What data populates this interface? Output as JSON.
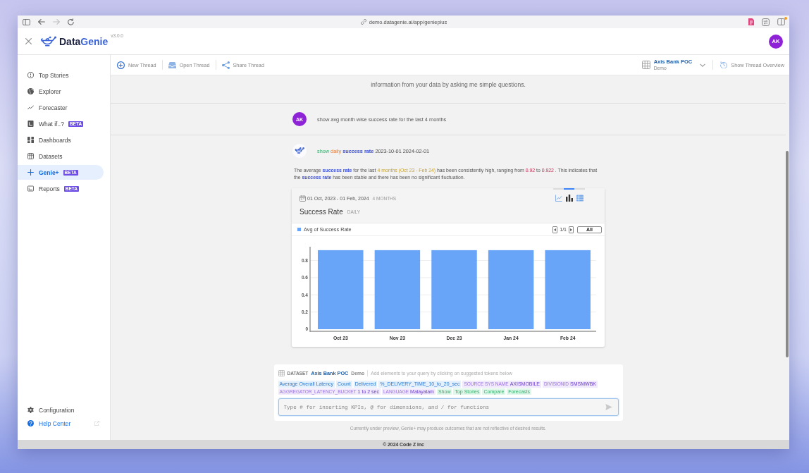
{
  "browser": {
    "url": "demo.datagenie.ai/app/genieplus",
    "can_go_forward": false,
    "notification_dot": true
  },
  "header": {
    "logo": [
      "Data",
      "Genie"
    ],
    "version": "v3.0.0",
    "avatar": "AK"
  },
  "sidebar": {
    "items": [
      {
        "label": "Top Stories",
        "selected": false
      },
      {
        "label": "Explorer",
        "selected": false
      },
      {
        "label": "Forecaster",
        "selected": false
      },
      {
        "label": "What if..?",
        "badge": "BETA",
        "selected": false
      },
      {
        "label": "Dashboards",
        "selected": false
      },
      {
        "label": "Datasets",
        "selected": false
      },
      {
        "label": "Genie+",
        "badge": "BETA",
        "selected": true
      },
      {
        "label": "Reports",
        "badge": "BETA",
        "selected": false
      }
    ],
    "footer_items": [
      {
        "label": "Configuration",
        "kind": "setting"
      },
      {
        "label": "Help Center",
        "kind": "external_link"
      }
    ]
  },
  "toolbar": {
    "actions": [
      "New Thread",
      "Open Thread",
      "Share Thread"
    ],
    "dataset": {
      "name": "Axis Bank POC",
      "tag": "Demo"
    },
    "overview_button": "Show Thread Overview"
  },
  "conversation": {
    "intro": "information from your data by asking me simple questions.",
    "user_message": {
      "avatar": "AK",
      "text": "show avg month wise success rate for the last 4 months"
    },
    "bot_response": {
      "query": [
        {
          "kind": "action",
          "text": "show"
        },
        {
          "kind": "grain",
          "text": "daily"
        },
        {
          "kind": "metric",
          "text": "success rate"
        },
        {
          "kind": "date",
          "text": "2023-10-01"
        },
        {
          "kind": "date",
          "text": "2024-02-01"
        }
      ],
      "summary": [
        {
          "kind": "plain",
          "text": "The average "
        },
        {
          "kind": "metric",
          "text": "success rate"
        },
        {
          "kind": "plain",
          "text": " for the last "
        },
        {
          "kind": "period",
          "text": "4 months (Oct 23 - Feb 24)"
        },
        {
          "kind": "plain",
          "text": " has been consistently high, ranging from "
        },
        {
          "kind": "value",
          "text": "0.92"
        },
        {
          "kind": "plain",
          "text": " to "
        },
        {
          "kind": "value",
          "text": "0.922"
        },
        {
          "kind": "plain",
          "text": " . This indicates that the "
        },
        {
          "kind": "metric",
          "text": "success rate"
        },
        {
          "kind": "plain",
          "text": " has been stable and there has been no significant fluctuation."
        }
      ],
      "chart_card": {
        "date_range": "01 Oct, 2023 - 01 Feb, 2024",
        "duration": "4 MONTHS",
        "title": "Success Rate",
        "grain": "DAILY",
        "views": [
          {
            "kind": "line",
            "selected": false
          },
          {
            "kind": "bar",
            "selected": true
          },
          {
            "kind": "table",
            "selected": false
          }
        ],
        "pager": {
          "page": "1/1",
          "all_button": "All"
        },
        "chart_data": {
          "type": "bar",
          "categories": [
            "Oct 23",
            "Nov 23",
            "Dec 23",
            "Jan 24",
            "Feb 24"
          ],
          "series": [
            {
              "name": "Avg of Success Rate",
              "color": "#68a4f8",
              "values": [
                0.92,
                0.92,
                0.92,
                0.92,
                0.92
              ]
            }
          ],
          "ylim": [
            0,
            0.96
          ],
          "yticks": [
            0,
            0.2,
            0.4,
            0.6,
            0.8
          ],
          "grid": true
        }
      }
    }
  },
  "composer": {
    "label": "DATASET",
    "dataset": "Axis Bank POC",
    "dataset_tag": "Demo",
    "hint": "Add elements to your query by clicking on suggested tokens below",
    "tokens": [
      {
        "kind": "metric",
        "text": "Average Overall Latency"
      },
      {
        "kind": "metric",
        "text": "Count"
      },
      {
        "kind": "metric",
        "text": "Delivered"
      },
      {
        "kind": "metric",
        "text": "%_DELIVERY_TIME_10_to_20_sec"
      },
      {
        "kind": "dimension",
        "label": "SOURCE SYS NAME",
        "text": "AXISMOBILE"
      },
      {
        "kind": "dimension",
        "label": "DIVISIONID",
        "text": "SMSMWBK"
      },
      {
        "kind": "dimension",
        "label": "AGGREGATOR_LATENCY_BUCKET",
        "text": "1 to 2 sec"
      },
      {
        "kind": "dimension",
        "label": "LANGUAGE",
        "text": "Malayalam"
      },
      {
        "kind": "action",
        "text": "Show"
      },
      {
        "kind": "action",
        "text": "Top Stories"
      },
      {
        "kind": "action",
        "text": "Compare"
      },
      {
        "kind": "action",
        "text": "Forecasts"
      }
    ],
    "input": {
      "placeholder": "Type # for inserting KPIs, @ for dimensions, and / for functions"
    }
  },
  "disclaimer": "Currently under preview, Genie+ may produce outcomes that are not reflective of desired results.",
  "footer": "© 2024 Code Z Inc"
}
